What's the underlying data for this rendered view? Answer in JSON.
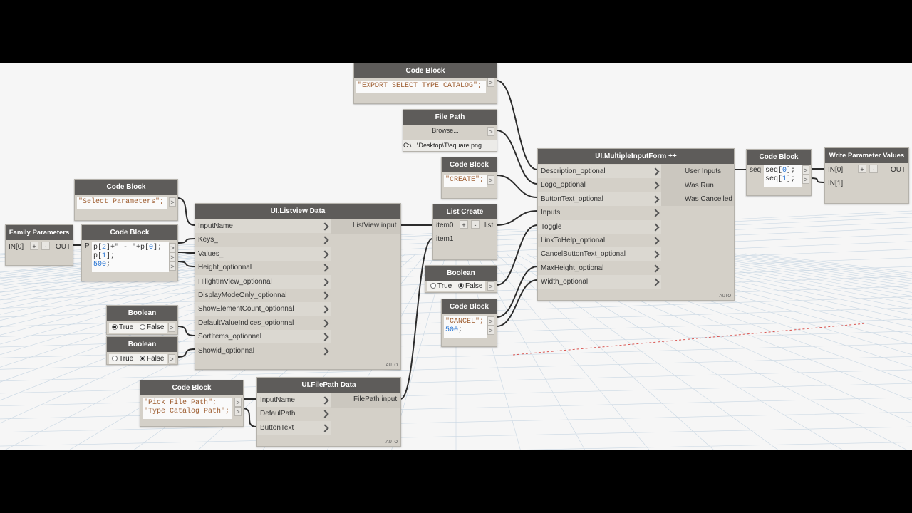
{
  "nodes": {
    "cb_export": {
      "title": "Code Block",
      "line1": "\"EXPORT SELECT TYPE CATALOG\";"
    },
    "filepath": {
      "title": "File Path",
      "button": "Browse...",
      "path": "C:\\...\\Desktop\\T\\square.png"
    },
    "cb_create": {
      "title": "Code Block",
      "line1": "\"CREATE\";"
    },
    "cb_select": {
      "title": "Code Block",
      "line1": "\"Select Parameters\";"
    },
    "family_params": {
      "title": "Family Parameters",
      "in": "IN[0]",
      "plus": "+",
      "minus": "-",
      "out": "OUT"
    },
    "cb_p": {
      "title": "Code Block",
      "port": "P",
      "line1a": "p[",
      "line1b": "2",
      "line1c": "]+\" - \"+p[",
      "line1d": "0",
      "line1e": "];",
      "line2a": "p[",
      "line2b": "1",
      "line2c": "];",
      "line3": "500",
      "line3b": ";"
    },
    "listview": {
      "title": "UI.Listview Data",
      "inputs": [
        "InputName",
        "Keys_",
        "Values_",
        "Height_optionnal",
        "HilightInView_optionnal",
        "DisplayModeOnly_optionnal",
        "ShowElementCount_optionnal",
        "DefaultValueIndices_optionnal",
        "SortItems_optionnal",
        "Showid_optionnal"
      ],
      "output": "ListView input",
      "auto": "AUTO"
    },
    "list_create": {
      "title": "List Create",
      "item0": "item0",
      "item1": "item1",
      "plus": "+",
      "minus": "-",
      "out": "list"
    },
    "bool_mid": {
      "title": "Boolean",
      "true_label": "True",
      "false_label": "False"
    },
    "cb_cancel": {
      "title": "Code Block",
      "line1": "\"CANCEL\";",
      "line2": "500",
      "line2b": ";"
    },
    "bool_a": {
      "title": "Boolean",
      "true_label": "True",
      "false_label": "False"
    },
    "bool_b": {
      "title": "Boolean",
      "true_label": "True",
      "false_label": "False"
    },
    "cb_pick": {
      "title": "Code Block",
      "line1": "\"Pick File Path\";",
      "line2": "\"Type Catalog Path\";"
    },
    "filepath_data": {
      "title": "UI.FilePath Data",
      "inputs": [
        "InputName",
        "DefaulPath",
        "ButtonText"
      ],
      "output": "FilePath input",
      "auto": "AUTO"
    },
    "multi_form": {
      "title": "UI.MultipleInputForm ++",
      "inputs": [
        "Description_optional",
        "Logo_optional",
        "ButtonText_optional",
        "Inputs",
        "Toggle",
        "LinkToHelp_optional",
        "CancelButtonText_optional",
        "MaxHeight_optional",
        "Width_optional"
      ],
      "outputs": [
        "User Inputs",
        "Was Run",
        "Was Cancelled"
      ],
      "auto": "AUTO"
    },
    "cb_seq": {
      "title": "Code Block",
      "port": "seq",
      "line1a": "seq[",
      "line1b": "0",
      "line1c": "];",
      "line2a": "seq[",
      "line2b": "1",
      "line2c": "];"
    },
    "write_params": {
      "title": "Write Parameter Values",
      "in0": "IN[0]",
      "in1": "IN[1]",
      "plus": "+",
      "minus": "-",
      "out": "OUT"
    }
  },
  "colors": {
    "header": "#5e5c5a",
    "node_body": "#d4d0c8",
    "wire": "#2c2c2c",
    "string": "#9c5a2c",
    "number": "#1f6fd1"
  }
}
